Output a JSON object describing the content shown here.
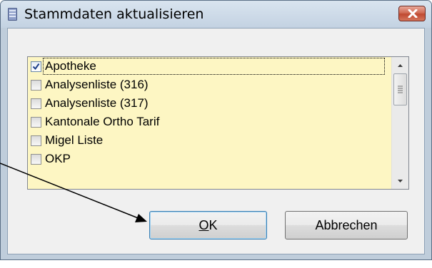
{
  "window": {
    "title": "Stammdaten aktualisieren",
    "close_label": "Schließen"
  },
  "list": {
    "items": [
      {
        "label": "Apotheke",
        "checked": true
      },
      {
        "label": "Analysenliste (316)",
        "checked": false
      },
      {
        "label": "Analysenliste (317)",
        "checked": false
      },
      {
        "label": "Kantonale Ortho Tarif",
        "checked": false
      },
      {
        "label": "Migel Liste",
        "checked": false
      },
      {
        "label": "OKP",
        "checked": false
      }
    ]
  },
  "buttons": {
    "ok_mnemonic": "O",
    "ok_rest": "K",
    "cancel_label": "Abbrechen"
  },
  "colors": {
    "list_background": "#fdf6c3",
    "close_button": "#c94c35"
  }
}
